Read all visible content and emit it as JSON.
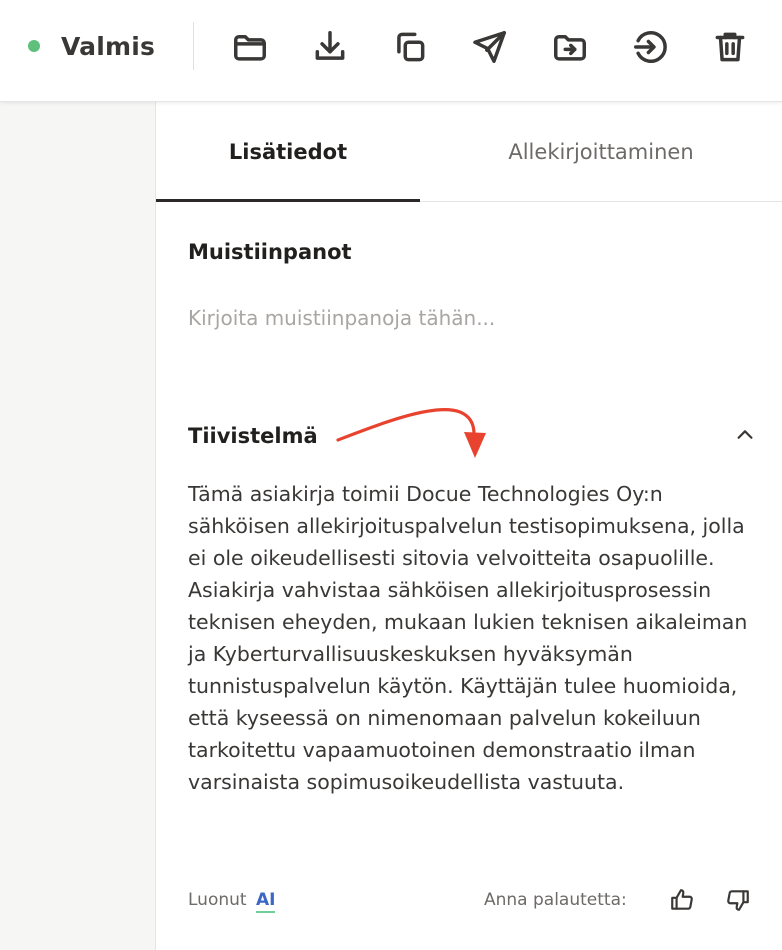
{
  "toolbar": {
    "status_label": "Valmis",
    "status_color": "#5ec07a",
    "icons": [
      "folder-icon",
      "download-icon",
      "copy-icon",
      "send-icon",
      "move-to-folder-icon",
      "sign-in-icon",
      "trash-icon"
    ]
  },
  "tabs": [
    {
      "label": "Lisätiedot",
      "active": true
    },
    {
      "label": "Allekirjoittaminen",
      "active": false
    }
  ],
  "notes": {
    "title": "Muistiinpanot",
    "placeholder": "Kirjoita muistiinpanoja tähän...",
    "value": ""
  },
  "summary": {
    "title": "Tiivistelmä",
    "text": "Tämä asiakirja toimii Docue Technologies Oy:n sähköisen allekirjoituspalvelun testisopimuksena, jolla ei ole oikeudellisesti sitovia velvoitteita osapuolille. Asiakirja vahvistaa sähköisen allekirjoitusprosessin teknisen eheyden, mukaan lukien teknisen aikaleiman ja Kyberturvallisuuskeskuksen hyväksymän tunnistuspalvelun käytön. Käyttäjän tulee huomioida, että kyseessä on nimenomaan palvelun kokeiluun tarkoitettu vapaamuotoinen demonstraatio ilman varsinaista sopimusoikeudellista vastuuta.",
    "expanded": true
  },
  "footer": {
    "created_by_label": "Luonut",
    "ai_label": "AI",
    "feedback_label": "Anna palautetta:"
  },
  "colors": {
    "annotation_arrow": "#e8432e",
    "ai_badge": "#3d67c4",
    "ai_underline": "#6fcf9a"
  }
}
